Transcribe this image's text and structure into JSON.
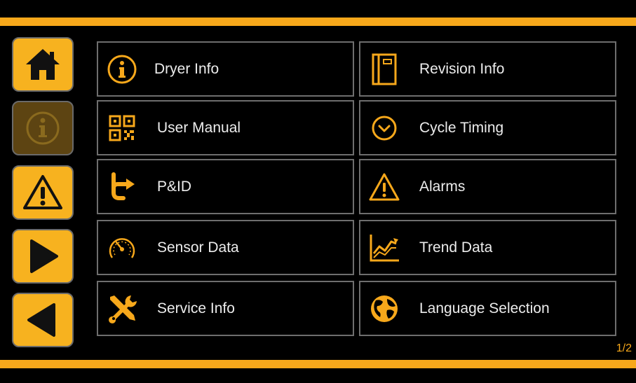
{
  "colors": {
    "accent": "#f7a81b",
    "background": "#000000",
    "border": "#6e6e6e",
    "text": "#ececec"
  },
  "sidebar": [
    {
      "icon": "home-icon",
      "disabled": false
    },
    {
      "icon": "info-icon",
      "disabled": true
    },
    {
      "icon": "warning-icon",
      "disabled": false
    },
    {
      "icon": "arrow-right-icon",
      "disabled": false
    },
    {
      "icon": "arrow-left-icon",
      "disabled": false
    }
  ],
  "menu": {
    "dryer_info": "Dryer Info",
    "revision_info": "Revision Info",
    "user_manual": "User Manual",
    "cycle_timing": "Cycle Timing",
    "pid": "P&ID",
    "alarms": "Alarms",
    "sensor_data": "Sensor Data",
    "trend_data": "Trend Data",
    "service_info": "Service Info",
    "language_selection": "Language Selection"
  },
  "page_indicator": "1/2"
}
